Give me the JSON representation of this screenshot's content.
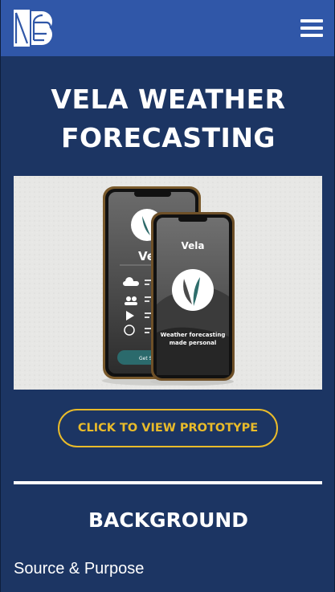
{
  "navbar": {
    "logo_icon": "sn-monogram-logo",
    "menu_icon": "hamburger-menu-icon",
    "background_color": "#3057a8"
  },
  "page": {
    "title": "VELA WEATHER FORECASTING",
    "background_color": "#1c3563"
  },
  "hero_image": {
    "description_icon": "phone-mockup-image",
    "front_phone": {
      "app_name": "Vela",
      "tagline_line1": "Weather forecasting",
      "tagline_line2": "made personal"
    },
    "back_phone": {
      "app_name_partial": "Ve",
      "button_partial": "Get St"
    }
  },
  "cta": {
    "label": "CLICK TO VIEW PROTOTYPE",
    "accent_color": "#e9bb2a"
  },
  "background_section": {
    "heading": "BACKGROUND",
    "subheading": "Source & Purpose"
  }
}
